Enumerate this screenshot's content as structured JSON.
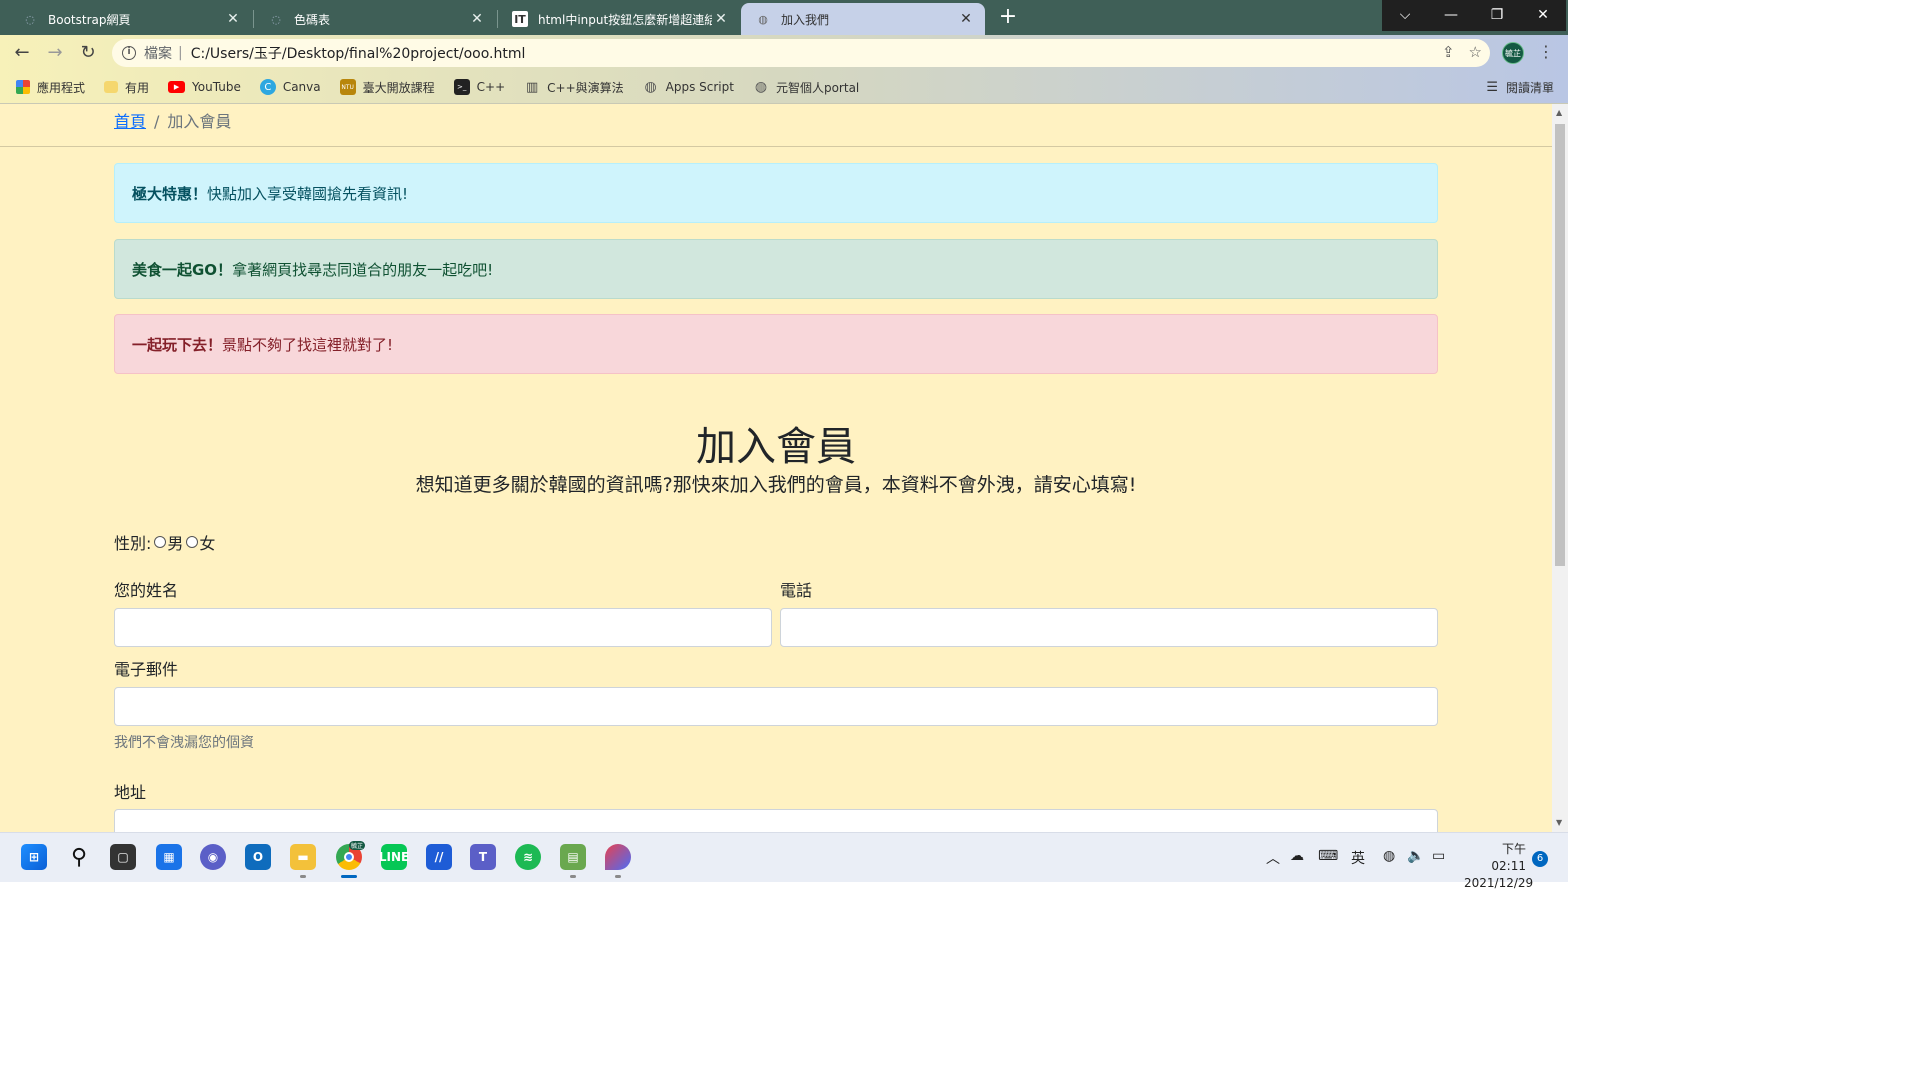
{
  "browser": {
    "tabs": [
      {
        "title": "Bootstrap網頁",
        "icon": "bootstrap-favicon"
      },
      {
        "title": "色碼表",
        "icon": "colorcode-favicon"
      },
      {
        "title": "html中input按鈕怎麼新增超連結",
        "icon": "it-favicon"
      },
      {
        "title": "加入我們",
        "icon": "globe-favicon",
        "active": true
      }
    ],
    "address": {
      "scheme_label": "檔案",
      "url": "C:/Users/玉子/Desktop/final%20project/ooo.html"
    },
    "profile_label": "毓芷",
    "bookmarks": [
      {
        "label": "應用程式",
        "icon": "apps-grid-icon"
      },
      {
        "label": "有用",
        "icon": "folder-icon"
      },
      {
        "label": "YouTube",
        "icon": "youtube-icon"
      },
      {
        "label": "Canva",
        "icon": "canva-icon"
      },
      {
        "label": "臺大開放課程",
        "icon": "ntu-ocw-icon"
      },
      {
        "label": "C++",
        "icon": "terminal-icon"
      },
      {
        "label": "C++與演算法",
        "icon": "book-icon"
      },
      {
        "label": "Apps Script",
        "icon": "globe-icon"
      },
      {
        "label": "元智個人portal",
        "icon": "globe-icon"
      }
    ],
    "reading_list": "閱讀清單"
  },
  "page": {
    "breadcrumb": {
      "home": "首頁",
      "sep": "/",
      "current": "加入會員"
    },
    "alerts": [
      {
        "strong": "極大特惠！",
        "text": "快點加入享受韓國搶先看資訊!",
        "type": "info",
        "color": "#cff4fc"
      },
      {
        "strong": "美食一起GO！",
        "text": "拿著網頁找尋志同道合的朋友一起吃吧!",
        "type": "success",
        "color": "#d1e7dd"
      },
      {
        "strong": "一起玩下去！",
        "text": "景點不夠了找這裡就對了!",
        "type": "danger",
        "color": "#f8d7da"
      }
    ],
    "title": "加入會員",
    "lead": "想知道更多關於韓國的資訊嗎?那快來加入我們的會員，本資料不會外洩，請安心填寫!",
    "form": {
      "gender_label": "性別:",
      "gender_male": "男",
      "gender_female": "女",
      "name_label": "您的姓名",
      "phone_label": "電話",
      "email_label": "電子郵件",
      "email_help": "我們不會洩漏您的個資",
      "address_label": "地址"
    },
    "background": "#fff2c2"
  },
  "taskbar": {
    "clock_period_time": "下午 02:11",
    "clock_date": "2021/12/29",
    "ime": "英",
    "notifications": "6",
    "chrome_badge": "毓芷"
  }
}
